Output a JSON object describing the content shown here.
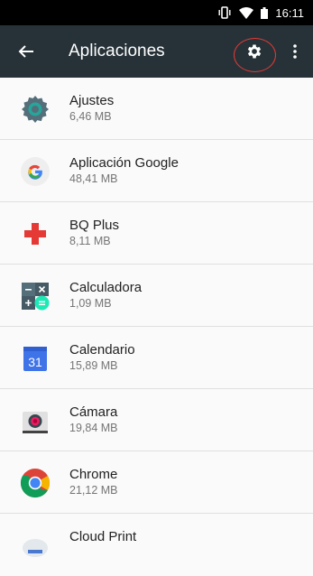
{
  "status_bar": {
    "time": "16:11"
  },
  "app_bar": {
    "title": "Aplicaciones"
  },
  "apps": [
    {
      "name": "Ajustes",
      "size": "6,46 MB",
      "icon": "settings-app-icon"
    },
    {
      "name": "Aplicación Google",
      "size": "48,41 MB",
      "icon": "google-app-icon"
    },
    {
      "name": "BQ Plus",
      "size": "8,11 MB",
      "icon": "bq-plus-icon"
    },
    {
      "name": "Calculadora",
      "size": "1,09 MB",
      "icon": "calculator-icon"
    },
    {
      "name": "Calendario",
      "size": "15,89 MB",
      "icon": "calendar-icon",
      "calendar_day": "31"
    },
    {
      "name": "Cámara",
      "size": "19,84 MB",
      "icon": "camera-icon"
    },
    {
      "name": "Chrome",
      "size": "21,12 MB",
      "icon": "chrome-icon"
    },
    {
      "name": "Cloud Print",
      "size": "",
      "icon": "cloud-print-icon"
    }
  ]
}
